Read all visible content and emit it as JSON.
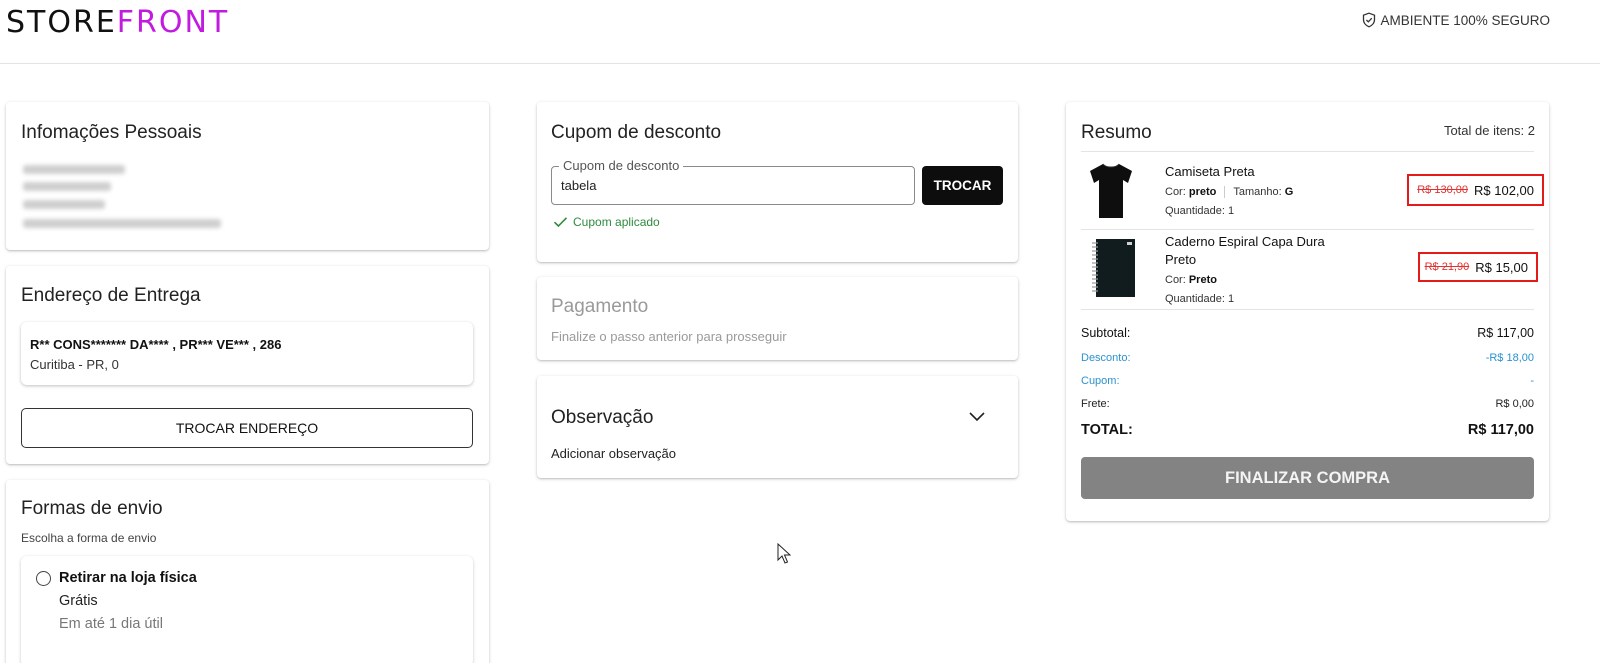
{
  "header": {
    "logo_part1": "STORE",
    "logo_part2": "FRONT",
    "secure_label": "AMBIENTE 100% SEGURO",
    "brand_color": "#c21be0"
  },
  "personal": {
    "title": "Infomações Pessoais"
  },
  "address": {
    "title": "Endereço de Entrega",
    "line1": "R** CONS******* DA**** , PR*** VE*** , 286",
    "line2": "Curitiba - PR, 0",
    "change_button": "TROCAR ENDEREÇO"
  },
  "shipping": {
    "title": "Formas de envio",
    "subtitle": "Escolha a forma de envio",
    "option": {
      "name": "Retirar na loja física",
      "price": "Grátis",
      "time": "Em até 1 dia útil"
    }
  },
  "coupon": {
    "title": "Cupom de desconto",
    "field_label": "Cupom de desconto",
    "field_value": "tabela",
    "button": "TROCAR",
    "status": "Cupom aplicado",
    "status_color": "#2e8b3e"
  },
  "payment": {
    "title": "Pagamento",
    "subtitle": "Finalize o passo anterior para prosseguir"
  },
  "observation": {
    "title": "Observação",
    "subtitle": "Adicionar observação"
  },
  "summary": {
    "title": "Resumo",
    "total_items": "Total de itens: 2",
    "products": [
      {
        "name": "Camiseta Preta",
        "color_label": "Cor:",
        "color_value": "preto",
        "size_label": "Tamanho:",
        "size_value": "G",
        "quantity": "Quantidade: 1",
        "old_price": "R$ 130,00",
        "price": "R$ 102,00"
      },
      {
        "name": "Caderno Espiral Capa Dura Preto",
        "color_label": "Cor:",
        "color_value": "Preto",
        "quantity": "Quantidade: 1",
        "old_price": "R$ 21,90",
        "price": "R$ 15,00"
      }
    ],
    "subtotal_label": "Subtotal:",
    "subtotal_value": "R$ 117,00",
    "discount_label": "Desconto:",
    "discount_value": "-R$ 18,00",
    "coupon_label": "Cupom:",
    "coupon_value": "-",
    "shipping_label": "Frete:",
    "shipping_value": "R$ 0,00",
    "total_label": "TOTAL:",
    "total_value": "R$ 117,00",
    "checkout_button": "FINALIZAR COMPRA",
    "link_color": "#2a92cf",
    "highlight_color": "#e31b1b"
  }
}
